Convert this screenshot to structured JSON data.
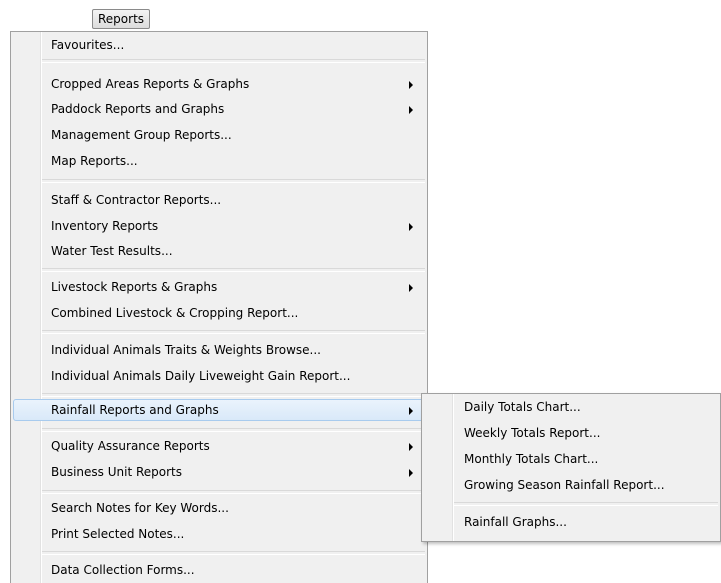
{
  "menubar": {
    "title": "Reports"
  },
  "menu": {
    "items": [
      {
        "label": "Favourites..."
      },
      {
        "label": "Cropped Areas Reports & Graphs",
        "submenu": true
      },
      {
        "label": "Paddock Reports and Graphs",
        "submenu": true
      },
      {
        "label": "Management Group Reports..."
      },
      {
        "label": "Map Reports..."
      },
      {
        "label": "Staff & Contractor Reports..."
      },
      {
        "label": "Inventory Reports",
        "submenu": true
      },
      {
        "label": "Water Test Results..."
      },
      {
        "label": "Livestock Reports & Graphs",
        "submenu": true
      },
      {
        "label": "Combined Livestock & Cropping Report..."
      },
      {
        "label": "Individual Animals Traits & Weights Browse..."
      },
      {
        "label": "Individual Animals Daily Liveweight Gain Report..."
      },
      {
        "label": "Rainfall Reports and Graphs",
        "submenu": true,
        "highlighted": true
      },
      {
        "label": "Quality Assurance Reports",
        "submenu": true
      },
      {
        "label": "Business Unit Reports",
        "submenu": true
      },
      {
        "label": "Search Notes for Key Words..."
      },
      {
        "label": "Print Selected Notes..."
      },
      {
        "label": "Data Collection Forms..."
      }
    ]
  },
  "submenu_rainfall": {
    "items": [
      {
        "label": "Daily Totals Chart..."
      },
      {
        "label": "Weekly Totals Report..."
      },
      {
        "label": "Monthly Totals Chart..."
      },
      {
        "label": "Growing Season Rainfall Report..."
      },
      {
        "label": "Rainfall Graphs..."
      }
    ]
  },
  "colors": {
    "menu_background": "#f0f0f0",
    "highlight_fill": "#dcebfa",
    "highlight_border": "#a8cbee"
  }
}
